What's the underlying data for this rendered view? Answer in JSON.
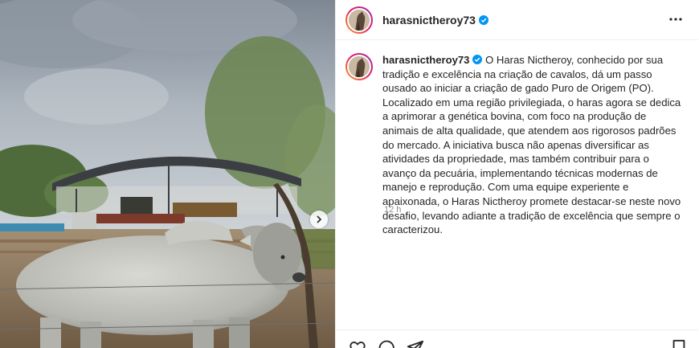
{
  "post": {
    "username": "harasnictheroy73",
    "verified": true,
    "caption_text": "O Haras Nictheroy, conhecido por sua tradição e excelência na criação de cavalos, dá um passo ousado ao iniciar a criação de gado Puro de Origem (PO). Localizado em uma região privilegiada, o haras agora se dedica a aprimorar a genética bovina, com foco na produção de animais de alta qualidade, que atendem aos rigorosos padrões do mercado. A iniciativa busca não apenas diversificar as atividades da propriedade, mas também contribuir para o avanço da pecuária, implementando técnicas modernas de manejo e reprodução. Com uma equipe experiente e apaixonada, o Haras Nictheroy promete destacar-se neste novo desafio, levando adiante a tradição de excelência que sempre o caracterizou.",
    "time_ago": "12 h"
  },
  "icons": {
    "verified": "verified-badge-icon",
    "more": "more-options-icon",
    "next": "chevron-right-icon",
    "like": "heart-icon",
    "comment": "comment-icon",
    "share": "paper-plane-icon",
    "save": "bookmark-icon"
  },
  "colors": {
    "verified_blue": "#0095f6",
    "text": "#262626",
    "secondary_text": "#8e8e8e",
    "divider": "#efefef"
  }
}
